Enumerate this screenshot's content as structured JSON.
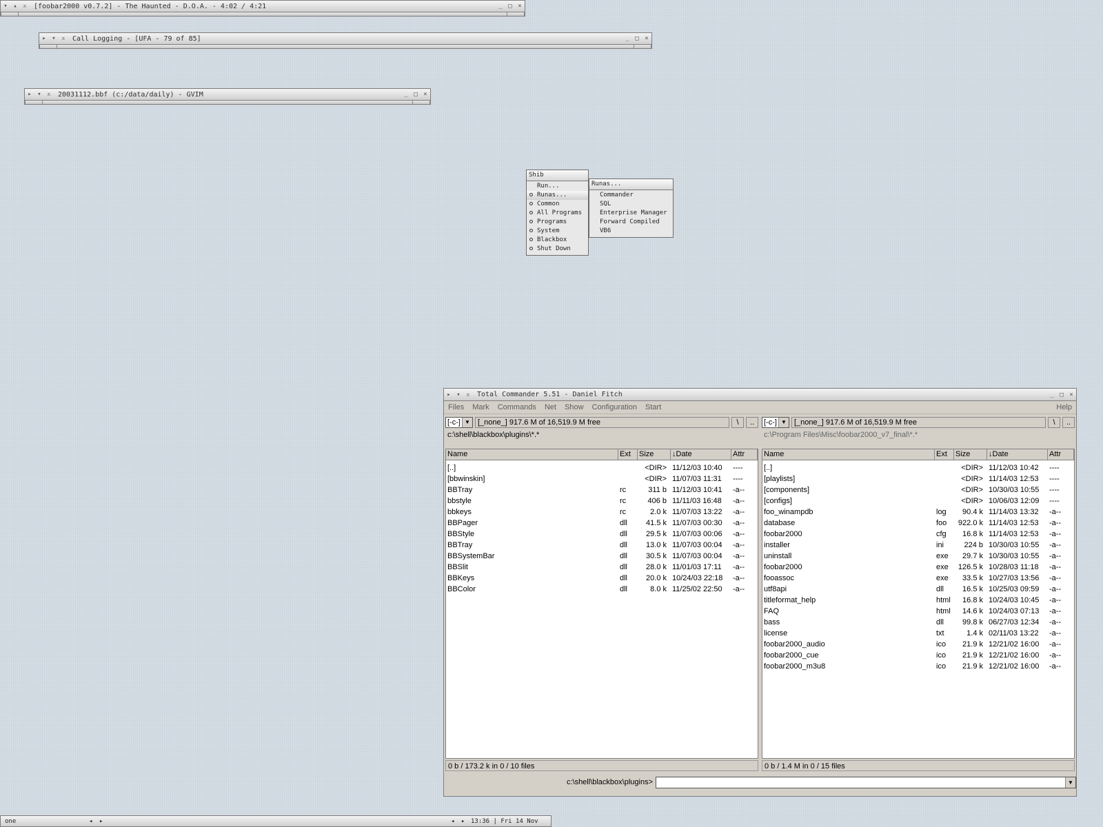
{
  "windows": {
    "foobar": {
      "title": "[foobar2000 v0.7.2] - The Haunted - D.O.A. - 4:02 / 4:21"
    },
    "calllog": {
      "title": "Call Logging - [UFA - 79 of 85]"
    },
    "gvim": {
      "title": "20031112.bbf (c:/data/daily) - GVIM"
    }
  },
  "title_buttons": {
    "collapse": "▸",
    "down": "▾",
    "sticky": "⌅",
    "minimize": "_",
    "maximize": "□",
    "close": "×",
    "up": "▴"
  },
  "menu": {
    "title": "Shib",
    "items": [
      {
        "label": "Run...",
        "bullet": false
      },
      {
        "label": "Runas...",
        "bullet": true,
        "active": true
      },
      {
        "label": "Common",
        "bullet": true
      },
      {
        "label": "All Programs",
        "bullet": true
      },
      {
        "label": "Programs",
        "bullet": true
      },
      {
        "label": "System",
        "bullet": true
      },
      {
        "label": "Blackbox",
        "bullet": true
      },
      {
        "label": "Shut Down",
        "bullet": true
      }
    ],
    "submenu": {
      "title": "Runas...",
      "items": [
        "Commander",
        "SQL",
        "Enterprise Manager",
        "Forward Compiled",
        "VB6"
      ]
    }
  },
  "tc": {
    "title": "Total Commander 5.51 - Daniel Fitch",
    "menubar": [
      "Files",
      "Mark",
      "Commands",
      "Net",
      "Show",
      "Configuration",
      "Start"
    ],
    "help": "Help",
    "columns": {
      "name": "Name",
      "ext": "Ext",
      "size": "Size",
      "date": "↓Date",
      "attr": "Attr"
    },
    "left": {
      "drive": "[-c-]",
      "free": "[_none_]  917.6 M of 16,519.9 M free",
      "root_btn": "\\",
      "up_btn": "..",
      "path": "c:\\shell\\blackbox\\plugins\\*.*",
      "status": "0 b / 173.2 k in 0 / 10 files",
      "files": [
        [
          "[..]",
          "",
          "<DIR>",
          "11/12/03 10:40",
          "----"
        ],
        [
          "[bbwinskin]",
          "",
          "<DIR>",
          "11/07/03 11:31",
          "----"
        ],
        [
          "BBTray",
          "rc",
          "311 b",
          "11/12/03 10:41",
          "-a--"
        ],
        [
          "bbstyle",
          "rc",
          "406 b",
          "11/11/03 16:48",
          "-a--"
        ],
        [
          "bbkeys",
          "rc",
          "2.0 k",
          "11/07/03 13:22",
          "-a--"
        ],
        [
          "BBPager",
          "dll",
          "41.5 k",
          "11/07/03 00:30",
          "-a--"
        ],
        [
          "BBStyle",
          "dll",
          "29.5 k",
          "11/07/03 00:06",
          "-a--"
        ],
        [
          "BBTray",
          "dll",
          "13.0 k",
          "11/07/03 00:04",
          "-a--"
        ],
        [
          "BBSystemBar",
          "dll",
          "30.5 k",
          "11/07/03 00:04",
          "-a--"
        ],
        [
          "BBSlit",
          "dll",
          "28.0 k",
          "11/01/03 17:11",
          "-a--"
        ],
        [
          "BBKeys",
          "dll",
          "20.0 k",
          "10/24/03 22:18",
          "-a--"
        ],
        [
          "BBColor",
          "dll",
          "8.0 k",
          "11/25/02 22:50",
          "-a--"
        ]
      ]
    },
    "right": {
      "drive": "[-c-]",
      "free": "[_none_]  917.6 M of 16,519.9 M free",
      "root_btn": "\\",
      "up_btn": "..",
      "path": "c:\\Program Files\\Misc\\foobar2000_v7_final\\*.*",
      "status": "0 b / 1.4 M in 0 / 15 files",
      "files": [
        [
          "[..]",
          "",
          "<DIR>",
          "11/12/03 10:42",
          "----"
        ],
        [
          "[playlists]",
          "",
          "<DIR>",
          "11/14/03 12:53",
          "----"
        ],
        [
          "[components]",
          "",
          "<DIR>",
          "10/30/03 10:55",
          "----"
        ],
        [
          "[configs]",
          "",
          "<DIR>",
          "10/06/03 12:09",
          "----"
        ],
        [
          "foo_winampdb",
          "log",
          "90.4 k",
          "11/14/03 13:32",
          "-a--"
        ],
        [
          "database",
          "foo",
          "922.0 k",
          "11/14/03 12:53",
          "-a--"
        ],
        [
          "foobar2000",
          "cfg",
          "16.8 k",
          "11/14/03 12:53",
          "-a--"
        ],
        [
          "installer",
          "ini",
          "224 b",
          "10/30/03 10:55",
          "-a--"
        ],
        [
          "uninstall",
          "exe",
          "29.7 k",
          "10/30/03 10:55",
          "-a--"
        ],
        [
          "foobar2000",
          "exe",
          "126.5 k",
          "10/28/03 11:18",
          "-a--"
        ],
        [
          "fooassoc",
          "exe",
          "33.5 k",
          "10/27/03 13:56",
          "-a--"
        ],
        [
          "utf8api",
          "dll",
          "16.5 k",
          "10/25/03 09:59",
          "-a--"
        ],
        [
          "titleformat_help",
          "html",
          "16.8 k",
          "10/24/03 10:45",
          "-a--"
        ],
        [
          "FAQ",
          "html",
          "14.6 k",
          "10/24/03 07:13",
          "-a--"
        ],
        [
          "bass",
          "dll",
          "99.8 k",
          "06/27/03 12:34",
          "-a--"
        ],
        [
          "license",
          "txt",
          "1.4 k",
          "02/11/03 13:22",
          "-a--"
        ],
        [
          "foobar2000_audio",
          "ico",
          "21.9 k",
          "12/21/02 16:00",
          "-a--"
        ],
        [
          "foobar2000_cue",
          "ico",
          "21.9 k",
          "12/21/02 16:00",
          "-a--"
        ],
        [
          "foobar2000_m3u8",
          "ico",
          "21.9 k",
          "12/21/02 16:00",
          "-a--"
        ]
      ]
    },
    "cmd_path": "c:\\shell\\blackbox\\plugins>",
    "cmd_value": ""
  },
  "toolbar": {
    "workspace": "one",
    "prev": "◂",
    "next": "▸",
    "clock": "13:36  |  Fri 14 Nov"
  }
}
